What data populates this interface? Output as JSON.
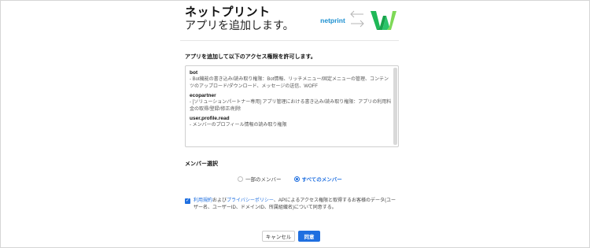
{
  "header": {
    "title": "ネットプリント",
    "subtitle": "アプリを追加します。",
    "source_logo_text": "netprint"
  },
  "permissions": {
    "heading": "アプリを追加して以下のアクセス権限を許可します。",
    "items": [
      {
        "name": "bot",
        "description": "- Bot機能の書き込み/読み取り権限：Bot情報、リッチメニュー/固定メニューの管理、コンテンツのアップロード/ダウンロード、メッセージの送信、WOFF"
      },
      {
        "name": "ecopartner",
        "description": "- [ソリューションパートナー専用] アプリ管理における書き込み/読み取り権限：アプリの利用料金の取得/登録/修正/削除"
      },
      {
        "name": "user.profile.read",
        "description": "- メンバーのプロフィール情報の読み取り権限"
      }
    ]
  },
  "members": {
    "heading": "メンバー選択",
    "options": [
      {
        "label": "一部のメンバー",
        "selected": false
      },
      {
        "label": "すべてのメンバー",
        "selected": true
      }
    ]
  },
  "consent": {
    "checked": true,
    "link_terms": "利用規約",
    "text_and": "および",
    "link_privacy": "プライバシーポリシー",
    "text_rest": "、APIによるアクセス権限と取得するお客様のデータ(ユーザー名、ユーザーID、ドメインID、所属組織名)について同意する。"
  },
  "buttons": {
    "cancel": "キャンセル",
    "agree": "同意"
  },
  "colors": {
    "accent": "#1f6fe0",
    "logo_green": "#2cc46b"
  }
}
